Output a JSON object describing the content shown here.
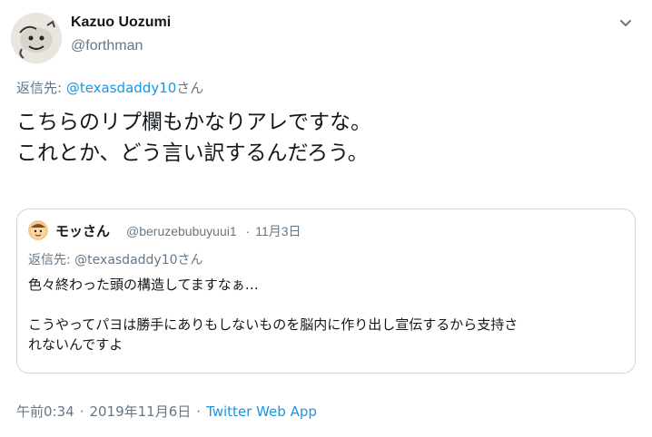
{
  "author": {
    "display_name": "Kazuo Uozumi",
    "handle": "@forthman"
  },
  "reply": {
    "prefix": "返信先: ",
    "mention": "@texasdaddy10",
    "suffix": "さん"
  },
  "main_text": {
    "line1": "こちらのリプ欄もかなりアレですな。",
    "line2": "これとか、どう言い訳するんだろう。"
  },
  "quote": {
    "display_name": "モッさん",
    "handle": "@beruzebubuyuui1",
    "separator": "·",
    "date": "11月3日",
    "reply_prefix": "返信先: ",
    "reply_mention": "@texasdaddy10",
    "reply_suffix": "さん",
    "line1": "色々終わった頭の構造してますなぁ…",
    "line2": "こうやってパヨは勝手にありもしないものを脳内に作り出し宣伝するから支持さ",
    "line3": "れないんですよ"
  },
  "footer": {
    "time": "午前0:34",
    "separator1": "·",
    "date": "2019年11月6日",
    "separator2": "·",
    "source": "Twitter Web App"
  },
  "icons": {
    "menu": "chevron-down-icon"
  },
  "colors": {
    "link": "#1b95e0",
    "secondary": "#657786",
    "text": "#14171a",
    "border": "#ccd6dd"
  }
}
